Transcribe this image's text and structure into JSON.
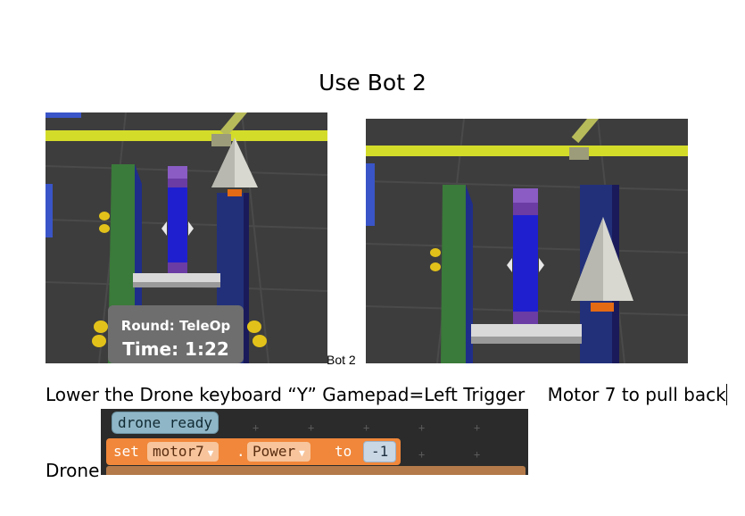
{
  "document": {
    "title": "Use Bot 2",
    "image_left": {
      "overlay_round": "Round: TeleOp",
      "overlay_time": "Time: 1:22"
    },
    "caption": "Bot 2",
    "instruction_line": "Lower the Drone keyboard “Y” Gamepad=Left Trigger    Motor 7 to pull back",
    "drone_label": "Drone"
  },
  "code_blocks": {
    "header_block": "drone ready",
    "set_keyword": "set",
    "motor_dropdown": "motor7",
    "dot": ".",
    "property_dropdown": "Power",
    "to_keyword": "to",
    "value": "-1"
  },
  "colors": {
    "yellow_bar": "#d4dc2a",
    "floor": "#3d3d3d",
    "blue_post": "#1f1fd0",
    "purple_post": "#8a5cc4",
    "green_rail": "#3a7a3a",
    "block_orange": "#f0873a",
    "block_teal": "#8fb6c6"
  },
  "icons": [
    "dropdown-arrow-icon",
    "drone-plane-icon"
  ]
}
